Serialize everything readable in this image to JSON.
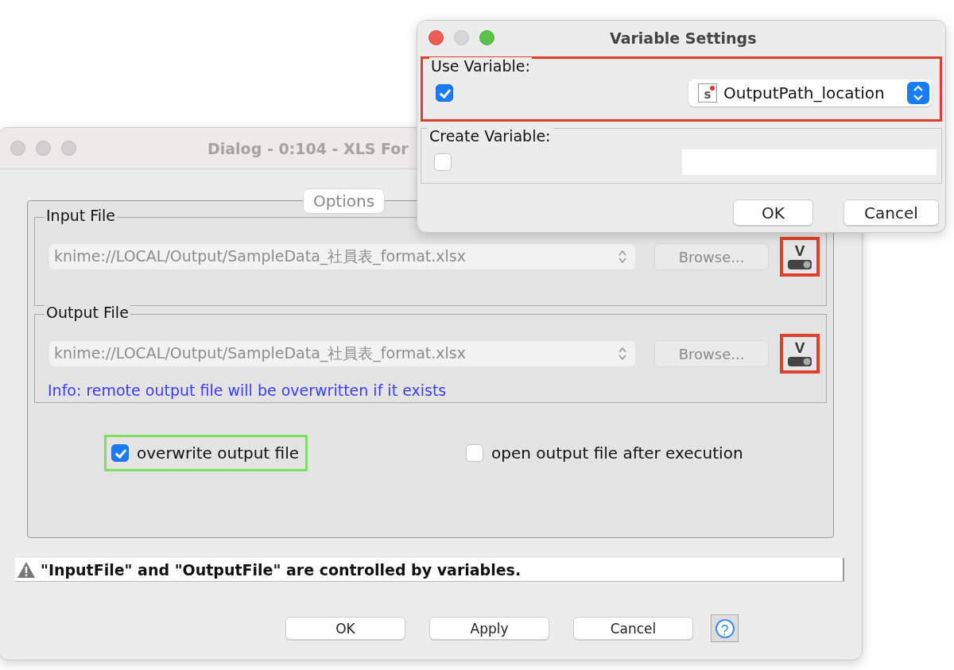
{
  "dialog": {
    "title": "Dialog - 0:104 - XLS For",
    "active": false,
    "tabs": [
      {
        "label": "Options",
        "selected": true
      }
    ],
    "file_groups": [
      {
        "legend": "Input File",
        "path": "knime://LOCAL/Output/SampleData_社員表_format.xlsx",
        "disabled": true,
        "browse_label": "Browse...",
        "variable_button": {
          "label": "V",
          "highlighted": true
        }
      },
      {
        "legend": "Output File",
        "path": "knime://LOCAL/Output/SampleData_社員表_format.xlsx",
        "disabled": true,
        "browse_label": "Browse...",
        "variable_button": {
          "label": "V",
          "highlighted": true
        },
        "info": "Info: remote output file will be overwritten if it exists"
      }
    ],
    "checkboxes": [
      {
        "label": "overwrite output file",
        "checked": true,
        "highlighted": true
      },
      {
        "label": "open output file after execution",
        "checked": false,
        "highlighted": false
      }
    ],
    "warning": "\"InputFile\" and \"OutputFile\" are controlled by variables.",
    "buttons": [
      "OK",
      "Apply",
      "Cancel"
    ],
    "help_label": "?"
  },
  "variable_settings": {
    "title": "Variable Settings",
    "active": true,
    "use_variable": {
      "legend": "Use Variable:",
      "checked": true,
      "type_badge": "s",
      "variable_name": "OutputPath_location",
      "highlighted": true
    },
    "create_variable": {
      "legend": "Create Variable:",
      "checked": false
    },
    "buttons": [
      "OK",
      "Cancel"
    ]
  }
}
